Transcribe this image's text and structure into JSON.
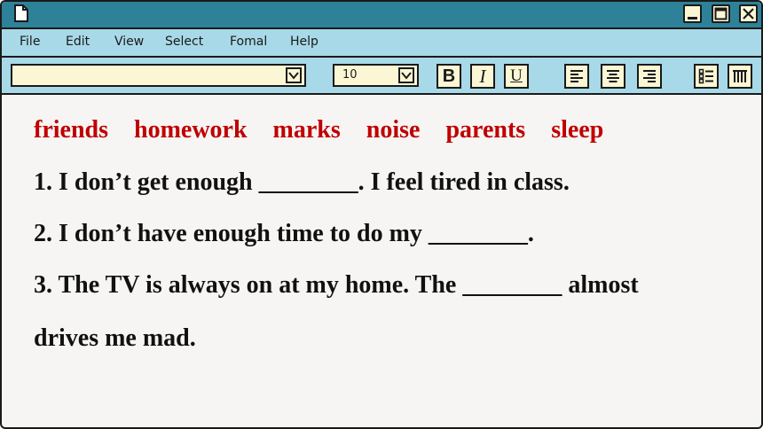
{
  "menu": {
    "items": [
      "File",
      "Edit",
      "View",
      "Select",
      "Fomal",
      "Help"
    ]
  },
  "toolbar": {
    "font_value": "",
    "size_value": "10",
    "bold_label": "B",
    "italic_label": "I",
    "underline_label": "U"
  },
  "content": {
    "word_bank": [
      "friends",
      "homework",
      "marks",
      "noise",
      "parents",
      "sleep"
    ],
    "lines": [
      "1. I don’t get enough ________. I feel tired in class.",
      "2. I don’t have enough time to do my ________.",
      "3. The TV is always on at my home. The ________ almost",
      "drives me mad."
    ]
  },
  "colors": {
    "titlebar": "#2d8299",
    "menubar": "#a8d9e8",
    "button_fill": "#fbf7d4",
    "word_bank_text": "#c00000",
    "body_text": "#111111",
    "page": "#f6f5f3"
  },
  "icons": {
    "document": "document-icon",
    "minimize": "minimize-icon",
    "maximize": "maximize-icon",
    "close": "close-icon",
    "dropdown": "chevron-down-icon",
    "align_left": "align-left-icon",
    "align_center": "align-center-icon",
    "align_right": "align-right-icon",
    "bullet_list": "bullet-list-icon",
    "columns": "columns-icon"
  }
}
